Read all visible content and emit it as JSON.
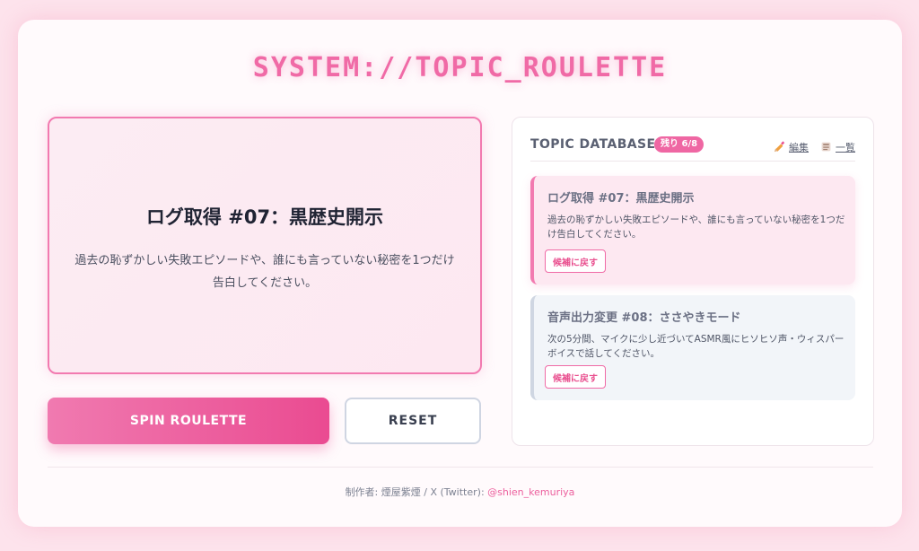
{
  "app": {
    "title": "SYSTEM://TOPIC_ROULETTE"
  },
  "display": {
    "title": "ログ取得 #07：黒歴史開示",
    "description": "過去の恥ずかしい失敗エピソードや、誰にも言っていない秘密を1つだけ告白してください。"
  },
  "controls": {
    "spin_label": "SPIN ROULETTE",
    "reset_label": "RESET"
  },
  "database": {
    "title": "TOPIC DATABASE",
    "badge": "残り 6/8",
    "edit_label": "編集",
    "list_label": "一覧",
    "edit_icon": "pencil-icon",
    "list_icon": "list-icon",
    "items": [
      {
        "title": "ログ取得 #07：黒歴史開示",
        "description": "過去の恥ずかしい失敗エピソードや、誰にも言っていない秘密を1つだけ告白してください。",
        "button_label": "候補に戻す",
        "active": true
      },
      {
        "title": "音声出力変更 #08：ささやきモード",
        "description": "次の5分間、マイクに少し近づいてASMR風にヒソヒソ声・ウィスパーボイスで話してください。",
        "button_label": "候補に戻す",
        "active": false
      }
    ]
  },
  "footer": {
    "credit": "制作者: 煙屋紫煙 / X (Twitter): ",
    "handle": "@shien_kemuriya"
  },
  "colors": {
    "accent": "#f06aa6",
    "accent_dark": "#ea4b91",
    "background": "#fde3ec",
    "card": "#fffafc"
  }
}
